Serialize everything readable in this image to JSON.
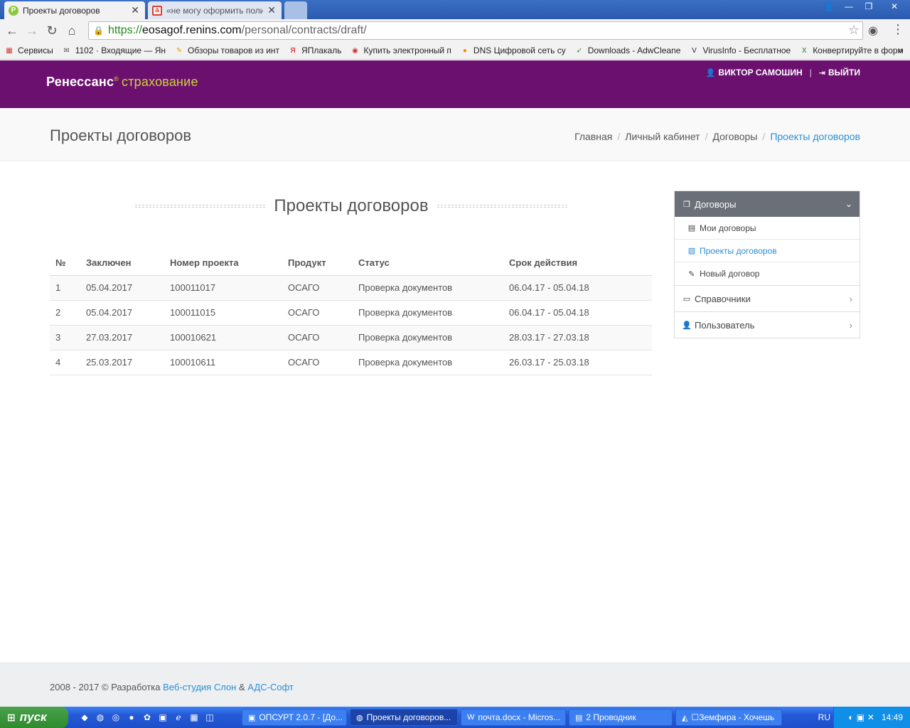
{
  "browser": {
    "tabs": [
      {
        "title": "Проекты договоров",
        "fav": "Р"
      },
      {
        "title": "«не могу оформить полис е",
        "fav": "a"
      }
    ],
    "window_controls": {
      "user": "👤",
      "minimize": "—",
      "maximize": "❐",
      "close": "✕"
    },
    "url": {
      "scheme": "https://",
      "host": "eosagof.renins.com",
      "path": "/personal/contracts/draft/"
    },
    "bookmarks": [
      {
        "label": "Сервисы",
        "icon": "apps-icon",
        "glyph": "▦",
        "color": "#d33"
      },
      {
        "label": "1102 · Входящие — Ян",
        "icon": "mail-icon",
        "glyph": "✉",
        "color": "#555"
      },
      {
        "label": "Обзоры товаров из инт",
        "icon": "pencil-icon",
        "glyph": "✎",
        "color": "#e8a000"
      },
      {
        "label": "ЯПлакаль",
        "icon": "yap-icon",
        "glyph": "Я",
        "color": "#c00"
      },
      {
        "label": "Купить электронный п",
        "icon": "shop-icon",
        "glyph": "◉",
        "color": "#c33"
      },
      {
        "label": "DNS Цифровой сеть су",
        "icon": "dns-icon",
        "glyph": "●",
        "color": "#f08a00"
      },
      {
        "label": "Downloads - AdwCleane",
        "icon": "rocket-icon",
        "glyph": "➶",
        "color": "#3a9b2a"
      },
      {
        "label": "VirusInfo - Бесплатное",
        "icon": "virusinfo-icon",
        "glyph": "V",
        "color": "#223"
      },
      {
        "label": "Конвертируйте в форм",
        "icon": "convert-icon",
        "glyph": "X",
        "color": "#1a7a1a"
      }
    ],
    "bookmarks_more": "»"
  },
  "header": {
    "logo": {
      "main": "Ренессанс",
      "reg": "®",
      "sub": "страхование"
    },
    "user_name": "ВИКТОР САМОШИН",
    "sep": "|",
    "logout": "ВЫЙТИ"
  },
  "page": {
    "title": "Проекты договоров",
    "breadcrumb": [
      "Главная",
      "Личный кабинет",
      "Договоры",
      "Проекты договоров"
    ],
    "breadcrumb_sep": "/"
  },
  "main": {
    "heading": "Проекты договоров",
    "table": {
      "columns": [
        "№",
        "Заключен",
        "Номер проекта",
        "Продукт",
        "Статус",
        "Срок действия"
      ],
      "rows": [
        [
          "1",
          "05.04.2017",
          "100011017",
          "ОСАГО",
          "Проверка документов",
          "06.04.17 - 05.04.18"
        ],
        [
          "2",
          "05.04.2017",
          "100011015",
          "ОСАГО",
          "Проверка документов",
          "06.04.17 - 05.04.18"
        ],
        [
          "3",
          "27.03.2017",
          "100010621",
          "ОСАГО",
          "Проверка документов",
          "28.03.17 - 27.03.18"
        ],
        [
          "4",
          "25.03.2017",
          "100010611",
          "ОСАГО",
          "Проверка документов",
          "26.03.17 - 25.03.18"
        ]
      ]
    }
  },
  "sidebar": {
    "section": "Договоры",
    "subitems": [
      "Мои договоры",
      "Проекты договоров",
      "Новый договор"
    ],
    "active_subitem": 1,
    "items": [
      "Справочники",
      "Пользователь"
    ]
  },
  "footer": {
    "text": "2008 - 2017 © Разработка",
    "link1": "Веб-студия Слон",
    "amp": "&",
    "link2": "АДС-Софт"
  },
  "taskbar": {
    "start": "пуск",
    "tasks": [
      {
        "label": "ОПСУРТ 2.0.7 - [До...",
        "icon": "app-icon",
        "glyph": "▣"
      },
      {
        "label": "Проекты договоров...",
        "icon": "chrome-icon",
        "glyph": "◍"
      },
      {
        "label": "почта.docx - Micros...",
        "icon": "word-icon",
        "glyph": "W"
      },
      {
        "label": "2 Проводник",
        "icon": "folder-icon",
        "glyph": "▤"
      },
      {
        "label": "☐Земфира - Хочешь",
        "icon": "aimp-icon",
        "glyph": "◭"
      }
    ],
    "lang": "RU",
    "clock": "14:49"
  }
}
